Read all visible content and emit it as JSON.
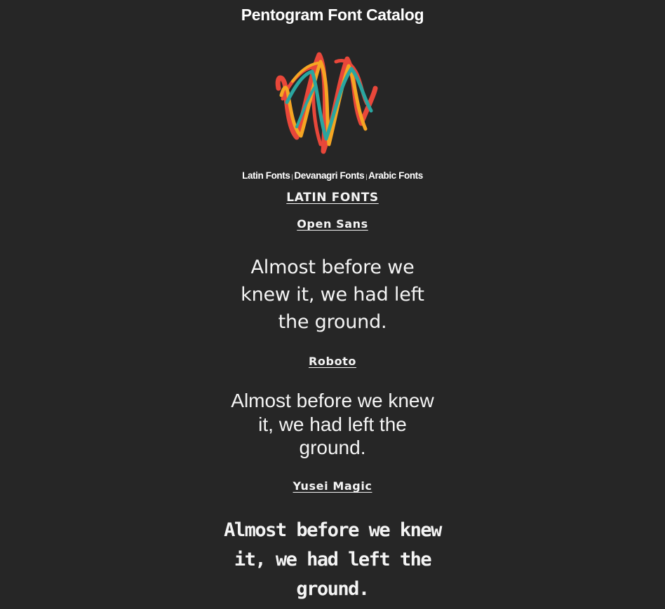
{
  "header": {
    "title": "Pentogram Font Catalog"
  },
  "logo": {
    "icon": "scribble-logo-icon",
    "colors": [
      "#e8473a",
      "#f5a623",
      "#2aa6a0"
    ]
  },
  "nav": {
    "items": [
      {
        "label": "Latin Fonts"
      },
      {
        "label": "Devanagri Fonts"
      },
      {
        "label": "Arabic Fonts"
      }
    ],
    "separator": "|"
  },
  "section": {
    "heading": "LATIN FONTS"
  },
  "fonts": [
    {
      "name": "Open Sans",
      "sample": "Almost before we knew it, we had left the ground."
    },
    {
      "name": "Roboto",
      "sample": "Almost before we knew it, we had left the ground."
    },
    {
      "name": "Yusei Magic",
      "sample": "Almost before we knew it, we had left the ground."
    }
  ],
  "colors": {
    "background": "#262626",
    "text": "#f2f2f2"
  }
}
